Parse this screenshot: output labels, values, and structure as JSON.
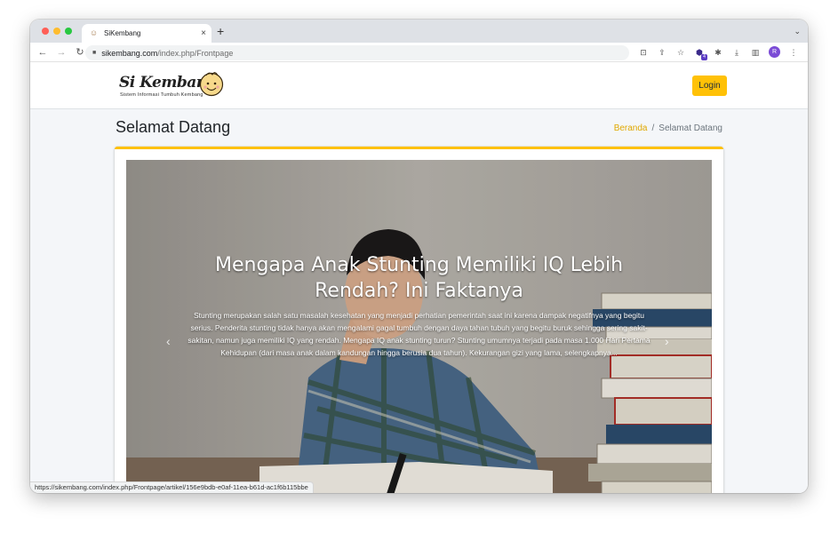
{
  "browser": {
    "tab_title": "SiKembang",
    "tab_favicon": "site-favicon",
    "url_host": "sikembang.com",
    "url_path": "/index.php/Frontpage",
    "profile_initial": "R",
    "status_url": "https://sikembang.com/index.php/Frontpage/artikel/156e9bdb-e0af-11ea-b61d-ac1f6b115bbe"
  },
  "site": {
    "brand_name": "Si Kembang",
    "brand_tagline": "Sistem Informasi Tumbuh Kembang",
    "login_label": "Login",
    "accent_color": "#ffc107"
  },
  "content": {
    "page_title": "Selamat Datang",
    "breadcrumb": {
      "home": "Beranda",
      "separator": "/",
      "current": "Selamat Datang"
    }
  },
  "carousel": {
    "slide_title": "Mengapa Anak Stunting Memiliki IQ Lebih Rendah? Ini Faktanya",
    "slide_text": "Stunting merupakan salah satu masalah kesehatan yang menjadi perhatian pemerintah saat ini karena dampak negatifnya yang begitu serius. Penderita stunting tidak hanya akan mengalami gagal tumbuh dengan daya tahan tubuh yang begitu buruk sehingga sering sakit-sakitan, namun juga memiliki IQ yang rendah. Mengapa IQ anak stunting turun? Stunting umumnya terjadi pada masa 1.000 Hari Pertama Kehidupan (dari masa anak dalam kandungan hingga berusia dua tahun). Kekurangan gizi yang lama, selengkapnya..."
  }
}
